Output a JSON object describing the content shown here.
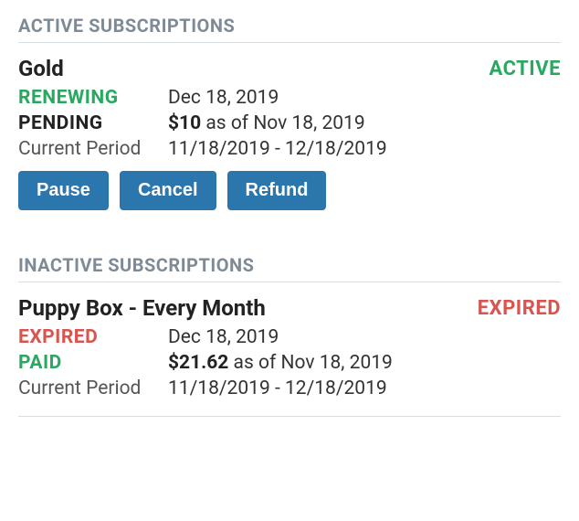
{
  "sections": {
    "active_header": "ACTIVE SUBSCRIPTIONS",
    "inactive_header": "INACTIVE SUBSCRIPTIONS"
  },
  "active_sub": {
    "title": "Gold",
    "status_badge": "ACTIVE",
    "renewing_label": "RENEWING",
    "renewing_value": "Dec 18, 2019",
    "pending_label": "PENDING",
    "pending_amount": "$10",
    "pending_asof": " as of Nov 18, 2019",
    "period_label": "Current Period",
    "period_value": "11/18/2019 - 12/18/2019",
    "actions": {
      "pause": "Pause",
      "cancel": "Cancel",
      "refund": "Refund"
    }
  },
  "inactive_sub": {
    "title": "Puppy Box - Every Month",
    "status_badge": "EXPIRED",
    "expired_label": "EXPIRED",
    "expired_value": "Dec 18, 2019",
    "paid_label": "PAID",
    "paid_amount": "$21.62",
    "paid_asof": " as of Nov 18, 2019",
    "period_label": "Current Period",
    "period_value": "11/18/2019 - 12/18/2019"
  }
}
